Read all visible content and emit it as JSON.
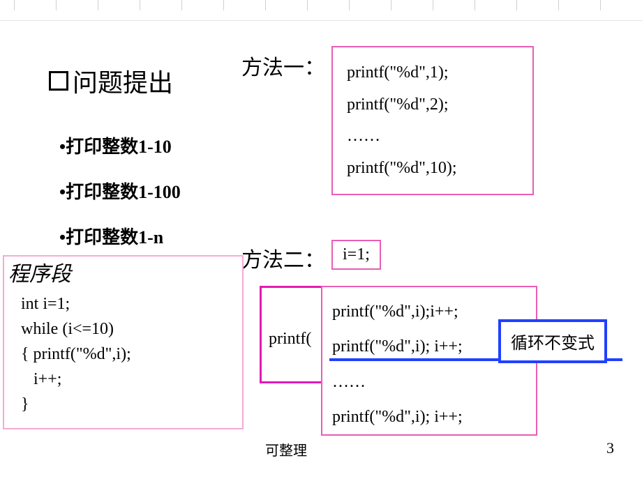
{
  "section_title": "问题提出",
  "bullets": [
    "•打印整数1-10",
    "•打印整数1-100",
    "•打印整数1-n"
  ],
  "method1": {
    "label": "方法一：",
    "lines": [
      "printf(\"%d\",1);",
      "printf(\"%d\",2);",
      "……",
      "printf(\"%d\",10);"
    ]
  },
  "method2": {
    "label": "方法二：",
    "init": "i=1;",
    "bg_text": "printf(",
    "lines": [
      "printf(\"%d\",i);i++;",
      "printf(\"%d\",i); i++;",
      "……",
      "printf(\"%d\",i); i++;"
    ]
  },
  "program": {
    "title": "程序段",
    "code": " int i=1;\n while (i<=10)\n { printf(\"%d\",i);\n    i++;\n }"
  },
  "invariant_label": "循环不变式",
  "footer": "可整理",
  "page_number": "3"
}
